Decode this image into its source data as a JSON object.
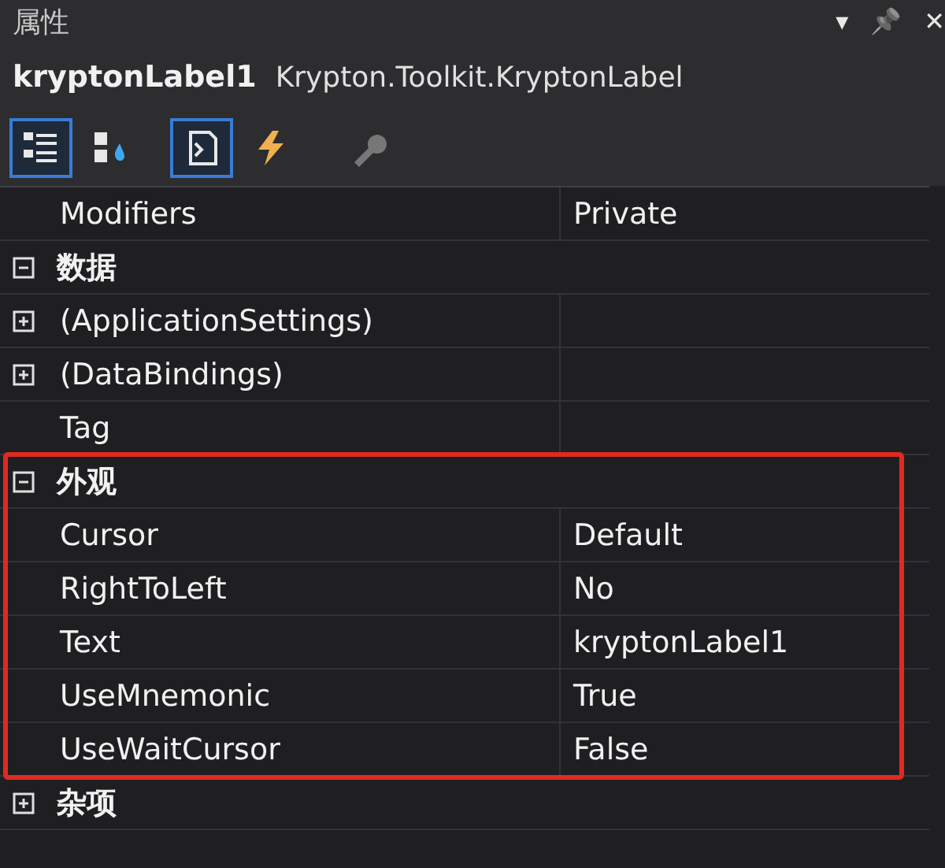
{
  "panel": {
    "title": "属性",
    "menu_glyph": "▾",
    "pin_glyph": "📌",
    "close_glyph": "✕"
  },
  "object": {
    "name": "kryptonLabel1",
    "type": "Krypton.Toolkit.KryptonLabel"
  },
  "toolbar": [
    {
      "kind": "categorized",
      "selected": true
    },
    {
      "kind": "alphabetical",
      "selected": false
    },
    {
      "kind": "properties",
      "selected": true
    },
    {
      "kind": "events",
      "selected": false
    },
    {
      "kind": "property-pages",
      "selected": false
    }
  ],
  "grid": [
    {
      "kind": "property",
      "name": "Modifiers",
      "value": "Private"
    },
    {
      "kind": "category",
      "name": "数据",
      "expanded": true,
      "highlighted": false,
      "children": [
        {
          "name": "(ApplicationSettings)",
          "expanded": false
        },
        {
          "name": "(DataBindings)",
          "expanded": false
        },
        {
          "name": "Tag"
        }
      ]
    },
    {
      "kind": "category",
      "name": "外观",
      "expanded": true,
      "highlighted": true,
      "children": [
        {
          "name": "Cursor",
          "value": "Default"
        },
        {
          "name": "RightToLeft",
          "value": "No"
        },
        {
          "name": "Text",
          "value": "kryptonLabel1"
        },
        {
          "name": "UseMnemonic",
          "value": "True"
        },
        {
          "name": "UseWaitCursor",
          "value": "False"
        }
      ]
    },
    {
      "kind": "category",
      "name": "杂项",
      "expanded": false,
      "highlighted": false
    }
  ]
}
